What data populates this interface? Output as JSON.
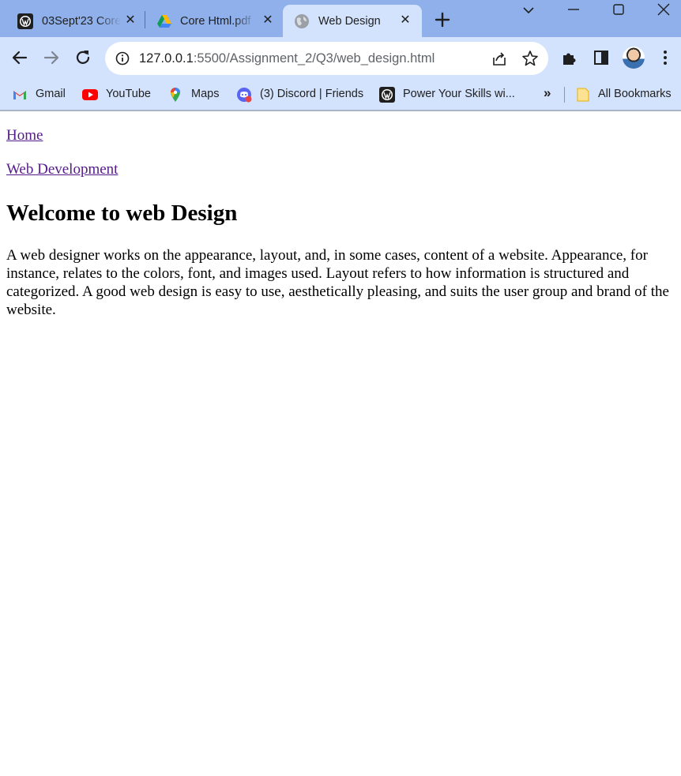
{
  "browser": {
    "tabs": [
      {
        "title": "03Sept'23 Core",
        "icon": "wordpress-favicon",
        "active": false
      },
      {
        "title": "Core Html.pdf",
        "icon": "google-drive-favicon",
        "active": false
      },
      {
        "title": "Web Design",
        "icon": "globe-favicon",
        "active": true
      }
    ],
    "address_bar": {
      "host": "127.0.0.1",
      "rest": ":5500/Assignment_2/Q3/web_design.html"
    },
    "bookmarks": [
      {
        "label": "Gmail",
        "icon": "gmail-icon"
      },
      {
        "label": "YouTube",
        "icon": "youtube-icon"
      },
      {
        "label": "Maps",
        "icon": "maps-icon"
      },
      {
        "label": "(3) Discord | Friends",
        "icon": "discord-icon"
      },
      {
        "label": "Power Your Skills wi...",
        "icon": "wordpress-favicon"
      }
    ],
    "all_bookmarks_label": "All Bookmarks",
    "overflow_label": "»",
    "colors": {
      "tabstrip": "#8fb0ea",
      "toolbar": "#d3e3fd",
      "link_visited": "#551a8b"
    }
  },
  "page": {
    "nav_links": [
      "Home",
      "Web Development"
    ],
    "heading": "Welcome to web Design",
    "paragraph": "A web designer works on the appearance, layout, and, in some cases, content of a website. Appearance, for instance, relates to the colors, font, and images used. Layout refers to how information is structured and categorized. A good web design is easy to use, aesthetically pleasing, and suits the user group and brand of the website."
  }
}
